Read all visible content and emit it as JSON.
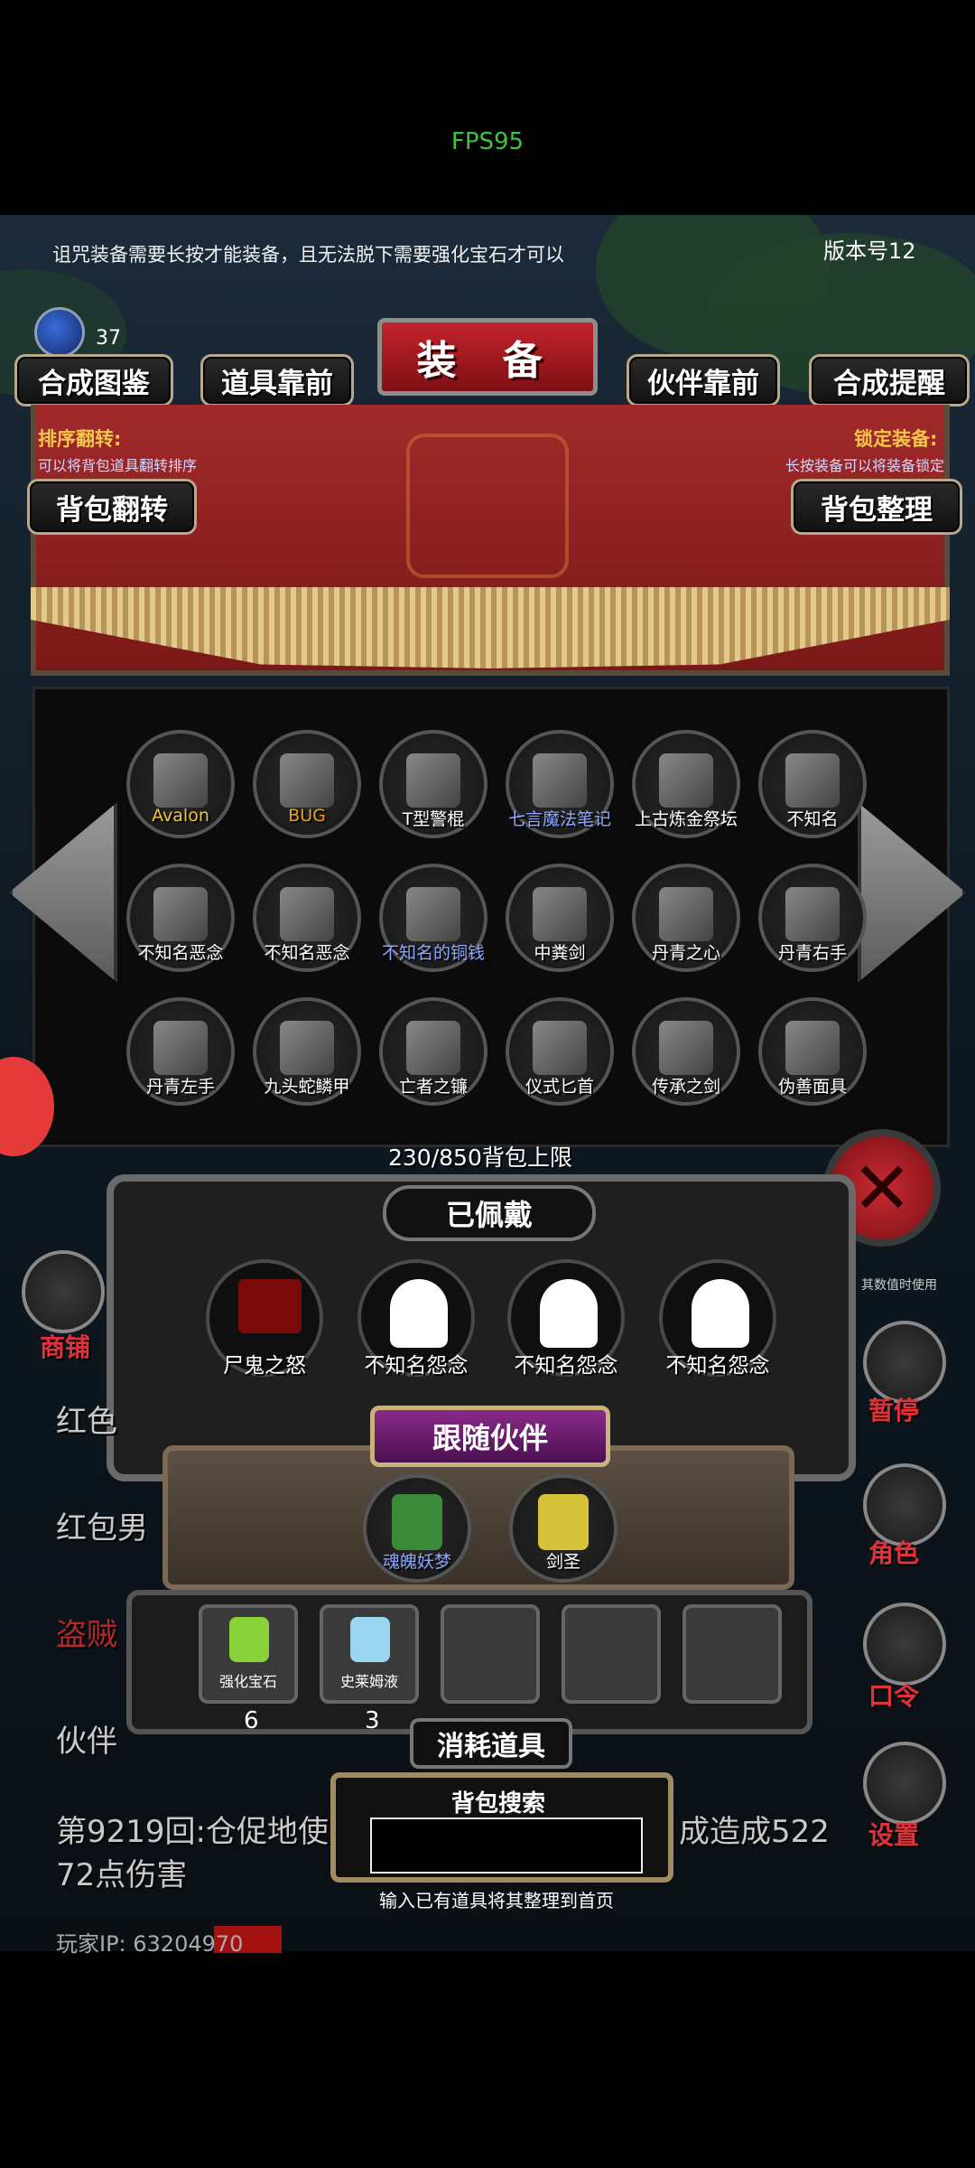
{
  "status": {
    "fps": "FPS95"
  },
  "header": {
    "notice": "诅咒装备需要长按才能装备，且无法脱下需要强化宝石才可以",
    "version": "版本号12",
    "gem_count": "37"
  },
  "top_buttons": {
    "synth_atlas": "合成图鉴",
    "items_first": "道具靠前",
    "title": "装 备",
    "partner_first": "伙伴靠前",
    "synth_reminder": "合成提醒"
  },
  "sort": {
    "label": "排序翻转:",
    "desc": "可以将背包道具翻转排序",
    "button": "背包翻转"
  },
  "lock": {
    "label": "锁定装备:",
    "desc": "长按装备可以将装备锁定",
    "button": "背包整理"
  },
  "inventory": {
    "capacity": "230/850背包上限",
    "items": [
      {
        "label": "Avalon",
        "icon": "golden-sword-icon",
        "color": "#f0c23a"
      },
      {
        "label": "BUG",
        "icon": "bug-question-icon",
        "color": "#e0a020"
      },
      {
        "label": "T型警棍",
        "icon": "baton-icon",
        "color": "#ffffff"
      },
      {
        "label": "七言魔法笔记",
        "icon": "magic-book-icon",
        "color": "#8aa6ff"
      },
      {
        "label": "上古炼金祭坛",
        "icon": "skull-altar-icon",
        "color": "#ffffff"
      },
      {
        "label": "不知名",
        "icon": "flame-icon",
        "color": "#ffffff"
      },
      {
        "label": "不知名恶念",
        "icon": "specter-icon",
        "color": "#ffffff"
      },
      {
        "label": "不知名恶念",
        "icon": "specter-icon",
        "color": "#ffffff"
      },
      {
        "label": "不知名的铜钱",
        "icon": "copper-coin-icon",
        "color": "#8aa6ff"
      },
      {
        "label": "中粪剑",
        "icon": "sword-icon",
        "color": "#ffffff"
      },
      {
        "label": "丹青之心",
        "icon": "serpent-heart-icon",
        "color": "#ffffff"
      },
      {
        "label": "丹青右手",
        "icon": "glove-icon",
        "color": "#ffffff"
      },
      {
        "label": "丹青左手",
        "icon": "glove-icon",
        "color": "#ffffff"
      },
      {
        "label": "九头蛇鳞甲",
        "icon": "leaf-armor-icon",
        "color": "#ffffff"
      },
      {
        "label": "亡者之镰",
        "icon": "scythe-icon",
        "color": "#ffffff"
      },
      {
        "label": "仪式匕首",
        "icon": "dagger-icon",
        "color": "#ffffff"
      },
      {
        "label": "传承之剑",
        "icon": "sword-icon",
        "color": "#ffffff"
      },
      {
        "label": "伪善面具",
        "icon": "red-mask-icon",
        "color": "#ffffff"
      }
    ]
  },
  "equipped": {
    "title": "已佩戴",
    "slots": [
      {
        "label": "尸鬼之怒",
        "icon": "claw-icon"
      },
      {
        "label": "不知名怨念",
        "icon": "ghost-icon"
      },
      {
        "label": "不知名怨念",
        "icon": "ghost-icon"
      },
      {
        "label": "不知名怨念",
        "icon": "ghost-icon"
      }
    ]
  },
  "companions": {
    "title": "跟随伙伴",
    "list": [
      {
        "label": "魂魄妖梦",
        "icon": "youmu-icon",
        "color": "#8aa6ff"
      },
      {
        "label": "剑圣",
        "icon": "swordsaint-icon",
        "color": "#ffffff"
      }
    ]
  },
  "consumables": {
    "title": "消耗道具",
    "items": [
      {
        "label": "强化宝石",
        "count": "6",
        "icon": "green-gem-icon"
      },
      {
        "label": "史莱姆液",
        "count": "3",
        "icon": "potion-icon"
      }
    ]
  },
  "search": {
    "title": "背包搜索",
    "hint": "输入已有道具将其整理到首页",
    "value": ""
  },
  "side": {
    "shop": "商铺",
    "pause": "暂停",
    "role": "角色",
    "command": "口令",
    "settings": "设置",
    "stat_partial": "其数值时使用"
  },
  "log": {
    "line1_left": "红色",
    "line2_left": "红包男",
    "line3_left": "盗贼",
    "line4_left": "伙伴",
    "battle_a": "第9219回:仓促地使",
    "battle_b": "成造成522",
    "battle_c": "72点伤害"
  },
  "player": {
    "ip": "玩家IP:  63204970"
  },
  "colors": {
    "accent_red": "#c4242c",
    "gold": "#f3c54a",
    "blue_label": "#8aa6ff"
  }
}
